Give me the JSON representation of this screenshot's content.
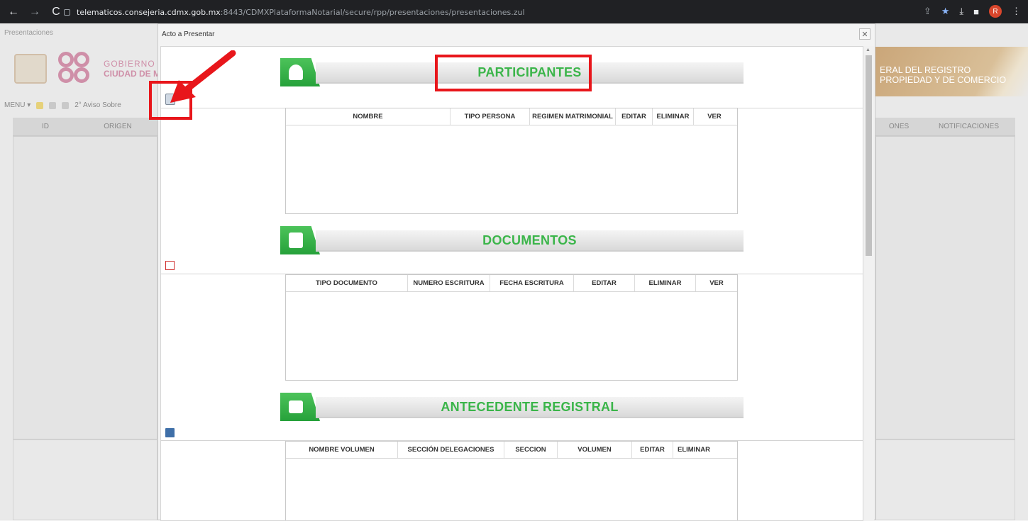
{
  "browser": {
    "url_host": "telematicos.consejeria.cdmx.gob.mx",
    "url_path": ":8443/CDMXPlataformaNotarial/secure/rpp/presentaciones/presentaciones.zul",
    "avatar_initial": "R"
  },
  "app": {
    "title": "Presentaciones",
    "gov_line1": "GOBIERNO D",
    "gov_line2": "CIUDAD DE MÉ",
    "registry_line1": "ERAL DEL REGISTRO",
    "registry_line2": "PROPIEDAD Y DE COMERCIO",
    "menu_label": "MENU ▾",
    "aviso_label": "2° Aviso Sobre",
    "columns": {
      "id": "ID",
      "origen": "ORIGEN",
      "ones": "ONES",
      "notificaciones": "NOTIFICACIONES"
    }
  },
  "modal": {
    "title": "Acto a Presentar",
    "close": "✕",
    "sections": {
      "participantes": {
        "title": "PARTICIPANTES",
        "columns": [
          "NOMBRE",
          "TIPO PERSONA",
          "REGIMEN MATRIMONIAL",
          "EDITAR",
          "ELIMINAR",
          "VER"
        ]
      },
      "documentos": {
        "title": "DOCUMENTOS",
        "columns": [
          "TIPO DOCUMENTO",
          "NUMERO ESCRITURA",
          "FECHA ESCRITURA",
          "EDITAR",
          "ELIMINAR",
          "VER"
        ]
      },
      "antecedente": {
        "title": "ANTECEDENTE REGISTRAL",
        "columns": [
          "NOMBRE VOLUMEN",
          "SECCIÓN DELEGACIONES",
          "SECCION",
          "VOLUMEN",
          "EDITAR",
          "ELIMINAR"
        ]
      }
    }
  },
  "colors": {
    "accent_green": "#3bb54a",
    "annotation_red": "#e8161b"
  }
}
